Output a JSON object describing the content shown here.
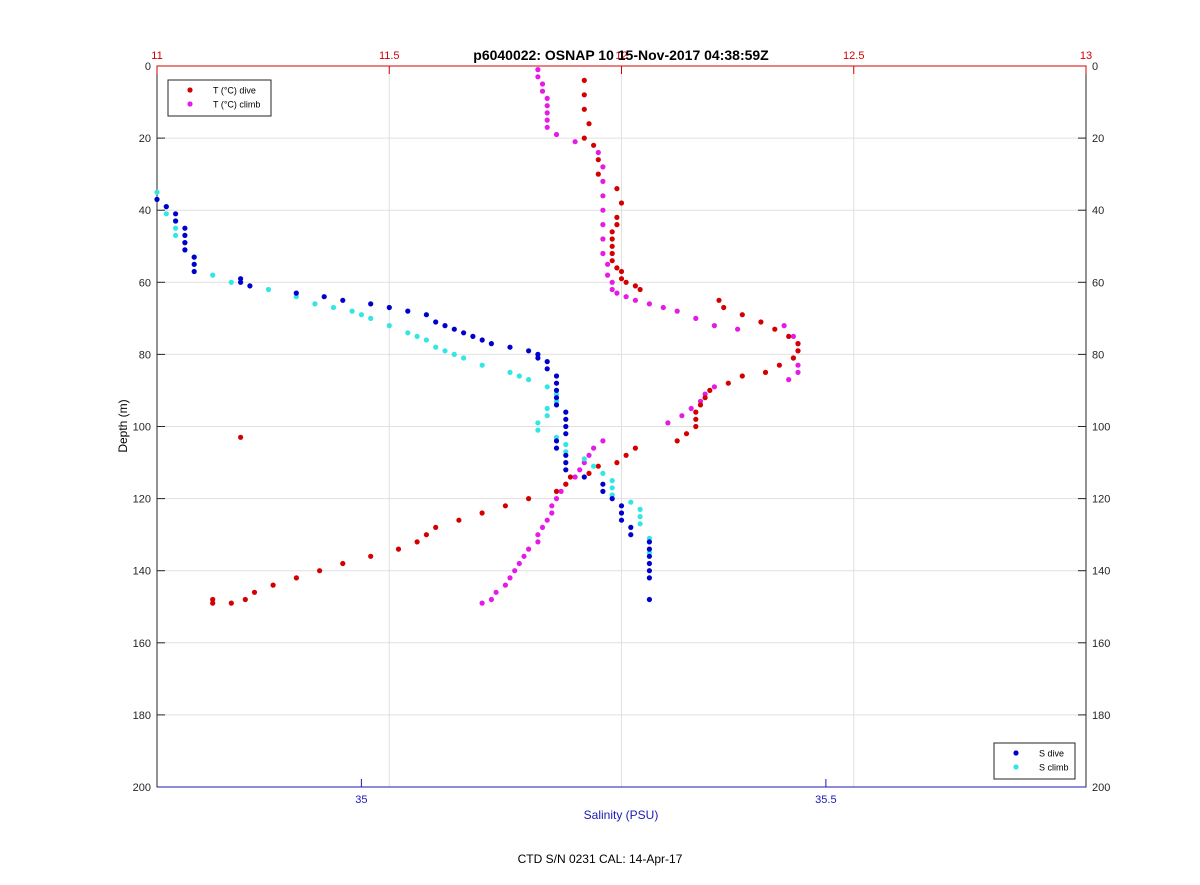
{
  "footer": "CTD S/N 0231  CAL: 14-Apr-17",
  "colors": {
    "t_dive": "#d40000",
    "t_climb": "#e619e6",
    "s_dive": "#0000cc",
    "s_climb": "#33e6e6",
    "temp_axis": "#d40000",
    "sal_axis": "#1a1ab3",
    "grid": "#e0e0e0"
  },
  "chart_data": {
    "type": "scatter",
    "title": "p6040022: OSNAP 10 15-Nov-2017 04:38:59Z",
    "ylabel": "Depth (m)",
    "ylim": [
      0,
      200
    ],
    "y_reversed": true,
    "y_ticks": [
      "0",
      "20",
      "40",
      "60",
      "80",
      "100",
      "120",
      "140",
      "160",
      "180",
      "200"
    ],
    "x_top": {
      "label": "",
      "lim": [
        11,
        13
      ],
      "ticks": [
        "11",
        "11.5",
        "12",
        "12.5",
        "13"
      ],
      "tick_values": [
        11,
        11.5,
        12,
        12.5,
        13
      ]
    },
    "x_bottom": {
      "label": "Salinity (PSU)",
      "lim": [
        34.78,
        35.78
      ],
      "ticks": [
        "35",
        "35.5"
      ],
      "tick_values": [
        35,
        35.5
      ]
    },
    "grid": true,
    "legend_top": {
      "placement": "top-left",
      "entries": [
        "T (°C) dive",
        "T (°C) climb"
      ]
    },
    "legend_bottom": {
      "placement": "bottom-right",
      "entries": [
        "S dive",
        "S climb"
      ]
    },
    "series": [
      {
        "name": "T (°C) dive",
        "axis": "top",
        "x": [
          11.92,
          11.92,
          11.92,
          11.93,
          11.92,
          11.94,
          11.95,
          11.95,
          11.99,
          12.0,
          11.99,
          11.99,
          11.98,
          11.98,
          11.98,
          11.98,
          11.98,
          11.99,
          12.0,
          12.0,
          12.01,
          12.03,
          12.04,
          12.21,
          12.22,
          12.26,
          12.3,
          12.33,
          12.36,
          12.38,
          12.38,
          12.37,
          12.34,
          12.31,
          12.26,
          12.23,
          12.19,
          12.18,
          12.17,
          12.16,
          12.16,
          12.16,
          12.14,
          12.12,
          12.03,
          12.01,
          11.99,
          11.95,
          11.93,
          11.89,
          11.88,
          11.86,
          11.8,
          11.75,
          11.7,
          11.65,
          11.6,
          11.58,
          11.56,
          11.52,
          11.46,
          11.4,
          11.35,
          11.3,
          11.25,
          11.21,
          11.19,
          11.16,
          11.12,
          11.12,
          11.18
        ],
        "y": [
          4,
          8,
          12,
          16,
          20,
          22,
          26,
          30,
          34,
          38,
          42,
          44,
          46,
          48,
          50,
          52,
          54,
          56,
          57,
          59,
          60,
          61,
          62,
          65,
          67,
          69,
          71,
          73,
          75,
          77,
          79,
          81,
          83,
          85,
          86,
          88,
          90,
          92,
          94,
          96,
          98,
          100,
          102,
          104,
          106,
          108,
          110,
          111,
          113,
          114,
          116,
          118,
          120,
          122,
          124,
          126,
          128,
          130,
          132,
          134,
          136,
          138,
          140,
          142,
          144,
          146,
          148,
          149,
          149,
          148,
          103
        ]
      },
      {
        "name": "T (°C) climb",
        "axis": "top",
        "x": [
          11.82,
          11.82,
          11.83,
          11.83,
          11.84,
          11.84,
          11.84,
          11.84,
          11.84,
          11.86,
          11.9,
          11.95,
          11.96,
          11.96,
          11.96,
          11.96,
          11.96,
          11.96,
          11.96,
          11.97,
          11.97,
          11.98,
          11.98,
          11.99,
          12.01,
          12.03,
          12.06,
          12.09,
          12.12,
          12.16,
          12.2,
          12.25,
          12.35,
          12.37,
          12.38,
          12.38,
          12.37,
          12.38,
          12.38,
          12.36,
          12.2,
          12.18,
          12.17,
          12.15,
          12.13,
          12.1,
          11.96,
          11.94,
          11.93,
          11.92,
          11.91,
          11.9,
          11.88,
          11.87,
          11.86,
          11.85,
          11.85,
          11.84,
          11.83,
          11.82,
          11.82,
          11.8,
          11.79,
          11.78,
          11.77,
          11.76,
          11.75,
          11.73,
          11.72,
          11.7
        ],
        "y": [
          1,
          3,
          5,
          7,
          9,
          11,
          13,
          15,
          17,
          19,
          21,
          24,
          28,
          32,
          36,
          40,
          44,
          48,
          52,
          55,
          58,
          60,
          62,
          63,
          64,
          65,
          66,
          67,
          68,
          70,
          72,
          73,
          72,
          75,
          77,
          79,
          81,
          83,
          85,
          87,
          89,
          91,
          93,
          95,
          97,
          99,
          104,
          106,
          108,
          110,
          112,
          114,
          116,
          118,
          120,
          122,
          124,
          126,
          128,
          130,
          132,
          134,
          136,
          138,
          140,
          142,
          144,
          146,
          148,
          149
        ]
      },
      {
        "name": "S dive",
        "axis": "bottom",
        "x": [
          34.78,
          34.79,
          34.8,
          34.8,
          34.81,
          34.81,
          34.81,
          34.81,
          34.82,
          34.82,
          34.82,
          34.87,
          34.87,
          34.88,
          34.93,
          34.96,
          34.98,
          35.01,
          35.03,
          35.05,
          35.07,
          35.08,
          35.09,
          35.1,
          35.11,
          35.12,
          35.13,
          35.14,
          35.16,
          35.18,
          35.19,
          35.19,
          35.2,
          35.2,
          35.21,
          35.21,
          35.21,
          35.21,
          35.21,
          35.22,
          35.22,
          35.22,
          35.22,
          35.21,
          35.21,
          35.22,
          35.22,
          35.22,
          35.24,
          35.26,
          35.26,
          35.27,
          35.28,
          35.28,
          35.28,
          35.29,
          35.29,
          35.31,
          35.31,
          35.31,
          35.31,
          35.31,
          35.31,
          35.31
        ],
        "y": [
          37,
          39,
          41,
          43,
          45,
          47,
          49,
          51,
          53,
          55,
          57,
          59,
          60,
          61,
          63,
          64,
          65,
          66,
          67,
          68,
          69,
          71,
          72,
          73,
          74,
          75,
          76,
          77,
          78,
          79,
          80,
          81,
          82,
          84,
          86,
          88,
          90,
          92,
          94,
          96,
          98,
          100,
          102,
          104,
          106,
          108,
          110,
          112,
          114,
          116,
          118,
          120,
          122,
          124,
          126,
          128,
          130,
          132,
          134,
          136,
          138,
          140,
          142,
          148
        ]
      },
      {
        "name": "S climb",
        "axis": "bottom",
        "x": [
          34.78,
          34.78,
          34.79,
          34.79,
          34.8,
          34.8,
          34.8,
          34.81,
          34.81,
          34.82,
          34.82,
          34.84,
          34.86,
          34.9,
          34.93,
          34.95,
          34.97,
          34.99,
          35.0,
          35.01,
          35.03,
          35.05,
          35.06,
          35.07,
          35.08,
          35.09,
          35.1,
          35.11,
          35.13,
          35.16,
          35.17,
          35.18,
          35.2,
          35.21,
          35.21,
          35.2,
          35.2,
          35.19,
          35.19,
          35.21,
          35.22,
          35.22,
          35.24,
          35.25,
          35.26,
          35.27,
          35.27,
          35.27,
          35.29,
          35.3,
          35.3,
          35.3,
          35.31,
          35.31
        ],
        "y": [
          35,
          37,
          39,
          41,
          43,
          45,
          47,
          49,
          51,
          53,
          55,
          58,
          60,
          62,
          64,
          66,
          67,
          68,
          69,
          70,
          72,
          74,
          75,
          76,
          78,
          79,
          80,
          81,
          83,
          85,
          86,
          87,
          89,
          91,
          93,
          95,
          97,
          99,
          101,
          103,
          105,
          107,
          109,
          111,
          113,
          115,
          117,
          119,
          121,
          123,
          125,
          127,
          131,
          135
        ]
      }
    ]
  }
}
